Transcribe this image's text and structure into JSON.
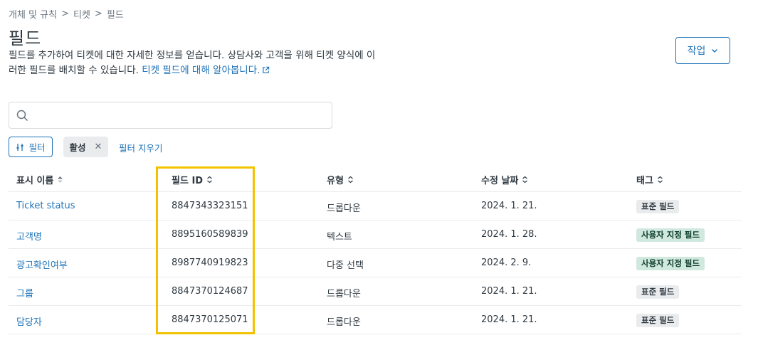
{
  "breadcrumb": {
    "items": [
      "개체 및 규칙",
      "티켓",
      "필드"
    ],
    "separator": ">"
  },
  "page": {
    "title": "필드",
    "description": "필드를 추가하여 티켓에 대한 자세한 정보를 얻습니다. 상담사와 고객을 위해 티켓 양식에 이러한 필드를 배치할 수 있습니다.",
    "learn_more": "티켓 필드에 대해 알아봅니다."
  },
  "actions": {
    "label": "작업"
  },
  "search": {
    "placeholder": "",
    "value": ""
  },
  "filters": {
    "filter_label": "필터",
    "active_chip": "활성",
    "clear_label": "필터 지우기"
  },
  "table": {
    "columns": [
      "표시 이름",
      "필드 ID",
      "유형",
      "수정 날짜",
      "태그"
    ],
    "rows": [
      {
        "name": "Ticket status",
        "id": "8847343323151",
        "type": "드롭다운",
        "date": "2024. 1. 21.",
        "tag": "표준 필드",
        "tag_kind": "std"
      },
      {
        "name": "고객명",
        "id": "8895160589839",
        "type": "텍스트",
        "date": "2024. 1. 28.",
        "tag": "사용자 지정 필드",
        "tag_kind": "custom"
      },
      {
        "name": "광고확인여부",
        "id": "8987740919823",
        "type": "다중 선택",
        "date": "2024. 2. 9.",
        "tag": "사용자 지정 필드",
        "tag_kind": "custom"
      },
      {
        "name": "그룹",
        "id": "8847370124687",
        "type": "드롭다운",
        "date": "2024. 1. 21.",
        "tag": "표준 필드",
        "tag_kind": "std"
      },
      {
        "name": "담당자",
        "id": "8847370125071",
        "type": "드롭다운",
        "date": "2024. 1. 21.",
        "tag": "표준 필드",
        "tag_kind": "std"
      }
    ]
  },
  "colors": {
    "accent": "#1f73b7",
    "highlight": "#f2c200",
    "custom_tag_bg": "#d1e8df",
    "std_tag_bg": "#e9ebed"
  }
}
